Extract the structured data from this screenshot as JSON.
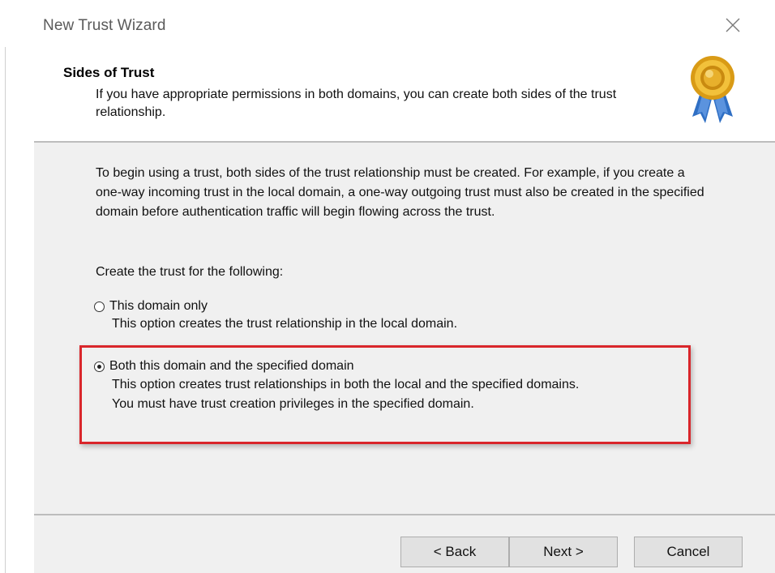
{
  "window": {
    "title": "New Trust Wizard",
    "close_icon": "close-icon"
  },
  "header": {
    "title": "Sides of Trust",
    "description": "If you have appropriate permissions in both domains, you can create both sides of the trust relationship.",
    "icon": "award-ribbon-icon"
  },
  "body": {
    "intro": "To begin using a trust, both sides of the trust relationship must be created. For example, if you create a one-way incoming trust in the local domain, a one-way outgoing trust must also be created in the specified domain before authentication traffic will begin flowing across the trust.",
    "prompt": "Create the trust for the following:",
    "options": [
      {
        "label": "This domain only",
        "description": "This option creates the trust relationship in the local domain.",
        "selected": false
      },
      {
        "label": "Both this domain and the specified domain",
        "description_line1": "This option creates trust relationships in both the local and the specified domains.",
        "description_line2": "You must have trust creation privileges in the specified domain.",
        "selected": true
      }
    ]
  },
  "footer": {
    "back_label": "< Back",
    "next_label": "Next >",
    "cancel_label": "Cancel"
  },
  "colors": {
    "highlight_border": "#d9262b",
    "body_background": "#f0f0f0",
    "button_background": "#e1e1e1"
  }
}
